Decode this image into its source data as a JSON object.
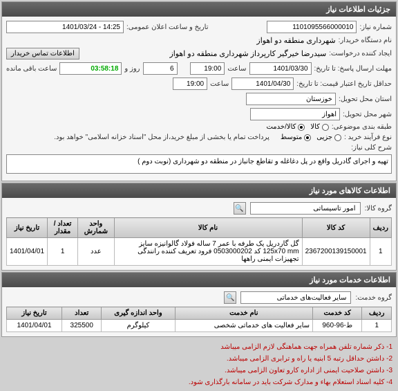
{
  "panel1": {
    "title": "جزئیات اطلاعات نیاز",
    "need_no_label": "شماره نیاز:",
    "need_no": "1101095566000010",
    "public_time_label": "تاریخ و ساعت اعلان عمومی:",
    "public_time": "14:25 - 1401/03/24",
    "buyer_label": "نام دستگاه خریدار:",
    "buyer": "شهرداری منطقه دو اهواز",
    "creator_label": "ایجاد کننده درخواست:",
    "creator": "سیدرضا خیرگیر کارپرداز  شهرداری منطقه دو اهواز",
    "contact_btn": "اطلاعات تماس خریدار",
    "deadline_label": "مهلت ارسال پاسخ: تا تاریخ:",
    "deadline_date": "1401/03/30",
    "time_label": "ساعت",
    "deadline_time": "19:00",
    "day_label": "روز و",
    "days": "6",
    "remaining_time": "03:58:18",
    "remaining_label": "ساعت باقی مانده",
    "min_valid_label": "حداقل تاریخ اعتبار قیمت: تا تاریخ:",
    "min_valid_date": "1401/04/30",
    "min_valid_time": "19:00",
    "province_label": "استان محل تحویل:",
    "province": "خوزستان",
    "city_label": "شهر محل تحویل:",
    "city": "اهواز",
    "category_label": "طبقه بندی موضوعی:",
    "cat_kala": "کالا",
    "cat_khadamat": "کالا/خدمت",
    "proc_label": "نوع فرآیند خرید :",
    "proc_partial": "جزیی",
    "proc_medium": "متوسط",
    "proc_note": "پرداخت تمام یا بخشی از مبلغ خرید،از محل \"اسناد خزانه اسلامی\" خواهد بود.",
    "desc_label": "شرح کلی نیاز:",
    "desc": "تهیه و اجرای گادریل واقع در پل دغاغله و تقاطع جانباز در منطقه دو شهرداری (نوبت دوم )"
  },
  "panel2": {
    "title": "اطلاعات کالاهای مورد نیاز",
    "group_label": "گروه کالا:",
    "group_value": "امور تاسیساتی",
    "headers": {
      "row": "ردیف",
      "code": "کد کالا",
      "name": "نام کالا",
      "unit": "واحد شمارش",
      "qty": "تعداد / مقدار",
      "date": "تاریخ نیاز"
    },
    "rows": [
      {
        "row": "1",
        "code": "2367200139150001",
        "name": "گل گاردریل یک طرفه با عمر 7 ساله فولاد گالوانیزه سایز 125x70 mm کد 0503000202 فرود تعریف کننده رانندگی تجهیزات ایمنی راهها",
        "unit": "عدد",
        "qty": "1",
        "date": "1401/04/01"
      }
    ]
  },
  "panel3": {
    "title": "اطلاعات خدمات مورد نیاز",
    "group_label": "گروه خدمت:",
    "group_value": "سایر فعالیت‌های خدماتی",
    "headers": {
      "row": "ردیف",
      "code": "کد خدمت",
      "name": "نام خدمت",
      "unit": "واحد اندازه گیری",
      "qty": "تعداد",
      "date": "تاریخ نیاز"
    },
    "rows": [
      {
        "row": "1",
        "code": "ط-96-960",
        "name": "سایر فعالیت های خدماتی شخصی",
        "unit": "کیلوگرم",
        "qty": "325500",
        "date": "1401/04/01"
      }
    ]
  },
  "notes": [
    "1- ذکر شماره تلفن همراه جهت هماهنگی لازم الزامی میباشد",
    "2- داشتن حداقل رتبه 5 ابنیه یا راه و ترابری الزامی میباشد.",
    "3- داشتن صلاحیت ایمنی از اداره کارو تعاون الزامی میباشد.",
    "4- کلیه اسناد استعلام بهاء و مدارک شرکت باید در سامانه بارگذاری شود."
  ]
}
